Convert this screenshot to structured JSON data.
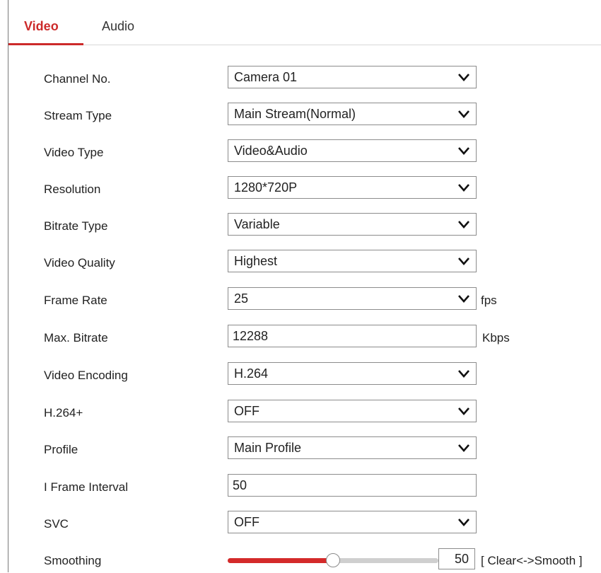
{
  "tabs": [
    {
      "label": "Video",
      "active": true
    },
    {
      "label": "Audio",
      "active": false
    }
  ],
  "colors": {
    "accent": "#cc2a2a",
    "slider_fill": "#d42a2a",
    "border": "#8c8c8c"
  },
  "form": {
    "channel_no": {
      "label": "Channel No.",
      "value": "Camera 01"
    },
    "stream_type": {
      "label": "Stream Type",
      "value": "Main Stream(Normal)"
    },
    "video_type": {
      "label": "Video Type",
      "value": "Video&Audio"
    },
    "resolution": {
      "label": "Resolution",
      "value": "1280*720P"
    },
    "bitrate_type": {
      "label": "Bitrate Type",
      "value": "Variable"
    },
    "video_quality": {
      "label": "Video Quality",
      "value": "Highest"
    },
    "frame_rate": {
      "label": "Frame Rate",
      "value": "25",
      "unit": "fps"
    },
    "max_bitrate": {
      "label": "Max. Bitrate",
      "value": "12288",
      "unit": "Kbps"
    },
    "video_encoding": {
      "label": "Video Encoding",
      "value": "H.264"
    },
    "h264_plus": {
      "label": "H.264+",
      "value": "OFF"
    },
    "profile": {
      "label": "Profile",
      "value": "Main Profile"
    },
    "i_frame_interval": {
      "label": "I Frame Interval",
      "value": "50"
    },
    "svc": {
      "label": "SVC",
      "value": "OFF"
    },
    "smoothing": {
      "label": "Smoothing",
      "value": "50",
      "level": 0.5,
      "hint": "[ Clear<->Smooth ]"
    }
  },
  "icons": {
    "dropdown": "chevron-down-icon"
  }
}
